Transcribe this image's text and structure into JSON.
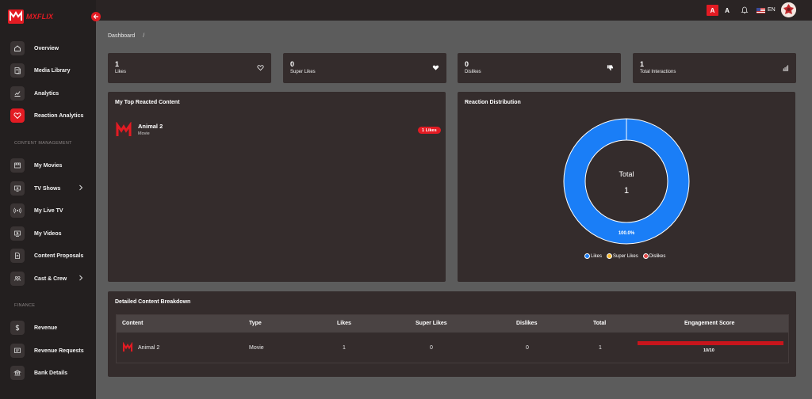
{
  "brand": {
    "name": "MXFLIX",
    "accent": "#e31b23"
  },
  "sidebar": {
    "items": [
      {
        "label": "Overview",
        "icon": "home-icon",
        "active": false
      },
      {
        "label": "Media Library",
        "icon": "library-icon",
        "active": false
      },
      {
        "label": "Analytics",
        "icon": "chart-icon",
        "active": false
      },
      {
        "label": "Reaction Analytics",
        "icon": "heart-icon",
        "active": true
      }
    ],
    "content_section": "CONTENT MANAGEMENT",
    "content_items": [
      {
        "label": "My Movies",
        "icon": "movie-icon",
        "chevron": false
      },
      {
        "label": "TV Shows",
        "icon": "tv-icon",
        "chevron": true
      },
      {
        "label": "My Live TV",
        "icon": "broadcast-icon",
        "chevron": false
      },
      {
        "label": "My Videos",
        "icon": "video-icon",
        "chevron": false
      },
      {
        "label": "Content Proposals",
        "icon": "document-icon",
        "chevron": false
      },
      {
        "label": "Cast & Crew",
        "icon": "people-icon",
        "chevron": true
      }
    ],
    "finance_section": "FINANCE",
    "finance_items": [
      {
        "label": "Revenue",
        "icon": "dollar-icon"
      },
      {
        "label": "Revenue Requests",
        "icon": "request-icon"
      },
      {
        "label": "Bank Details",
        "icon": "bank-icon"
      }
    ]
  },
  "header": {
    "font_size_large": "A",
    "font_size_small": "A",
    "language": "EN"
  },
  "breadcrumb": {
    "page": "Dashboard",
    "separator": "/"
  },
  "stats": [
    {
      "value": "1",
      "label": "Likes",
      "icon": "heart-outline-icon"
    },
    {
      "value": "0",
      "label": "Super Likes",
      "icon": "heart-filled-icon"
    },
    {
      "value": "0",
      "label": "Dislikes",
      "icon": "thumbs-down-icon"
    },
    {
      "value": "1",
      "label": "Total Interactions",
      "icon": "bar-chart-icon"
    }
  ],
  "top_content": {
    "title": "My Top Reacted Content",
    "items": [
      {
        "name": "Animal 2",
        "type": "Movie",
        "badge": "1 Likes"
      }
    ]
  },
  "distribution": {
    "title": "Reaction Distribution",
    "center_label": "Total",
    "center_value": "1",
    "slice_label": "100.0%",
    "legend": [
      {
        "label": "Likes",
        "color": "#1a7ef7"
      },
      {
        "label": "Super Likes",
        "color": "#f5b82e"
      },
      {
        "label": "Dislikes",
        "color": "#e34a4a"
      }
    ]
  },
  "chart_data": {
    "type": "pie",
    "categories": [
      "Likes",
      "Super Likes",
      "Dislikes"
    ],
    "values": [
      1,
      0,
      0
    ],
    "title": "Reaction Distribution",
    "legend_placement": "bottom"
  },
  "breakdown": {
    "title": "Detailed Content Breakdown",
    "columns": [
      "Content",
      "Type",
      "Likes",
      "Super Likes",
      "Dislikes",
      "Total",
      "Engagement Score"
    ],
    "rows": [
      {
        "content": "Animal 2",
        "type": "Movie",
        "likes": "1",
        "super_likes": "0",
        "dislikes": "0",
        "total": "1",
        "engagement": "10/10",
        "engagement_value": 1.0
      }
    ]
  }
}
